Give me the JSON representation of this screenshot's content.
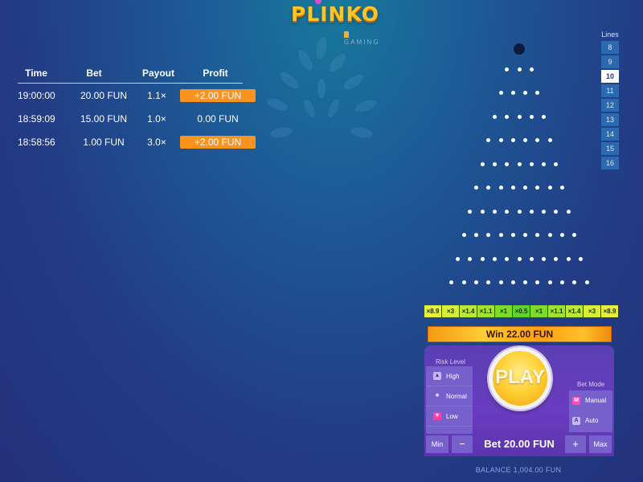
{
  "logo": {
    "title": "PLINKO",
    "subtitle": "GAMING"
  },
  "history": {
    "headers": {
      "time": "Time",
      "bet": "Bet",
      "payout": "Payout",
      "profit": "Profit"
    },
    "rows": [
      {
        "time": "19:00:00",
        "bet": "20.00 FUN",
        "payout": "1.1×",
        "profit": "+2.00 FUN",
        "highlight": true
      },
      {
        "time": "18:59:09",
        "bet": "15.00 FUN",
        "payout": "1.0×",
        "profit": "0.00 FUN",
        "highlight": false
      },
      {
        "time": "18:58:56",
        "bet": "1.00 FUN",
        "payout": "3.0×",
        "profit": "+2.00 FUN",
        "highlight": true
      }
    ]
  },
  "lines": {
    "title": "Lines",
    "options": [
      "8",
      "9",
      "10",
      "11",
      "12",
      "13",
      "14",
      "15",
      "16"
    ],
    "selected": "10"
  },
  "board": {
    "rows": 10
  },
  "multipliers": [
    {
      "label": "×8.9",
      "color": "#e6f03a"
    },
    {
      "label": "×3",
      "color": "#d6ef36"
    },
    {
      "label": "×1.4",
      "color": "#bbe832"
    },
    {
      "label": "×1.1",
      "color": "#9fe32e"
    },
    {
      "label": "×1",
      "color": "#7edb29"
    },
    {
      "label": "×0.5",
      "color": "#5fd426"
    },
    {
      "label": "×1",
      "color": "#7edb29"
    },
    {
      "label": "×1.1",
      "color": "#9fe32e"
    },
    {
      "label": "×1.4",
      "color": "#bbe832"
    },
    {
      "label": "×3",
      "color": "#d6ef36"
    },
    {
      "label": "×8.9",
      "color": "#e6f03a"
    }
  ],
  "win": {
    "label": "Win 22.00 FUN"
  },
  "risk": {
    "title": "Risk Level",
    "options": [
      "High",
      "Normal",
      "Low"
    ],
    "selected": "Low"
  },
  "bet_mode": {
    "title": "Bet Mode",
    "manual": "Manual",
    "manual_key": "M",
    "auto": "Auto",
    "auto_key": "A"
  },
  "play": {
    "label": "PLAY"
  },
  "stake": {
    "min": "Min",
    "minus": "−",
    "bet": "Bet 20.00 FUN",
    "plus": "+",
    "max": "Max"
  },
  "balance": {
    "label": "BALANCE 1,004.00 FUN"
  }
}
